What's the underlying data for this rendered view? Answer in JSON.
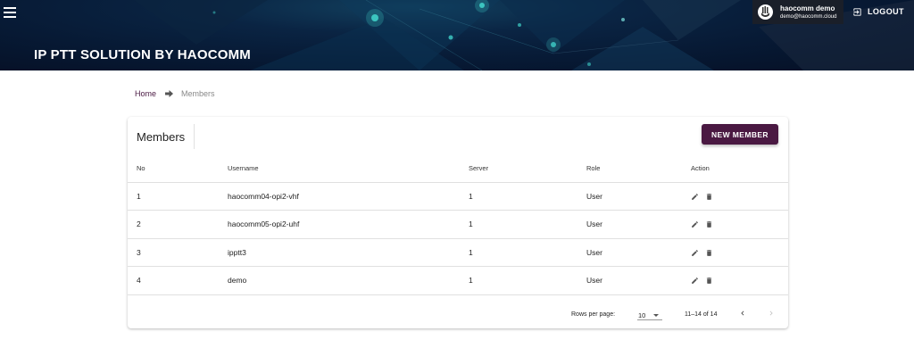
{
  "header": {
    "title": "IP PTT SOLUTION BY HAOCOMM",
    "user_name": "haocomm demo",
    "user_email": "demo@haocomm.cloud",
    "logout_label": "LOGOUT"
  },
  "breadcrumb": {
    "home": "Home",
    "current": "Members"
  },
  "card": {
    "title": "Members",
    "new_button": "NEW MEMBER"
  },
  "table": {
    "headers": [
      "No",
      "Username",
      "Server",
      "Role",
      "Action"
    ],
    "rows": [
      {
        "no": "1",
        "username": "haocomm04-opi2-vhf",
        "server": "1",
        "role": "User"
      },
      {
        "no": "2",
        "username": "haocomm05-opi2-uhf",
        "server": "1",
        "role": "User"
      },
      {
        "no": "3",
        "username": "ipptt3",
        "server": "1",
        "role": "User"
      },
      {
        "no": "4",
        "username": "demo",
        "server": "1",
        "role": "User"
      }
    ]
  },
  "pagination": {
    "rows_per_page_label": "Rows per page:",
    "rows_per_page": "10",
    "range": "11–14 of 14"
  },
  "colors": {
    "accent": "#4a1942",
    "header_bg": "#071a35"
  }
}
